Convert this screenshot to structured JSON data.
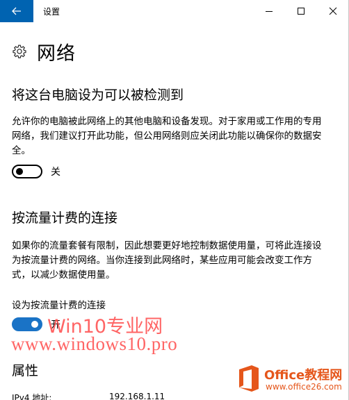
{
  "window": {
    "title": "设置",
    "back_icon": "back-arrow-icon",
    "minimize_icon": "minimize-icon",
    "maximize_icon": "maximize-icon",
    "close_icon": "close-icon",
    "accent_color": "#0063b1"
  },
  "page": {
    "icon": "gear-icon",
    "title": "网络"
  },
  "discovery": {
    "title": "将这台电脑设为可以被检测到",
    "description": "允许你的电脑被此网络上的其他电脑和设备发现。对于家用或工作用的专用网络，我们建议打开此功能，但公用网络则应关闭此功能以确保你的数据安全。",
    "toggle_on": false,
    "toggle_label": "关"
  },
  "metered": {
    "title": "按流量计费的连接",
    "description": "如果你的流量套餐有限制，因此想要更好地控制数据使用量，可将此连接设为按流量计费的网络。当你连接到此网络时，某些应用可能会改变工作方式，以减少数据使用量。",
    "setting_label": "设为按流量计费的连接",
    "toggle_on": true,
    "toggle_label": "开",
    "toggle_color": "#1a73c6"
  },
  "properties": {
    "title": "属性",
    "ipv4_key": "IPv4 地址:",
    "ipv4_value": "192.168.1.11"
  },
  "watermark": {
    "line1": "Win10专业网",
    "line2": "www.windows10.pro",
    "color": "#ff4b4b"
  },
  "logo": {
    "name": "Office教程网",
    "url": "www.office26.com",
    "color": "#e5561b"
  }
}
